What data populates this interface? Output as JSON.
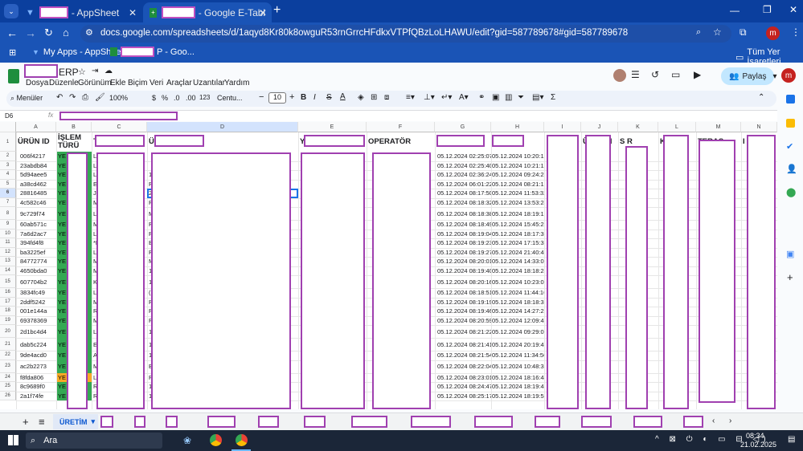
{
  "browser": {
    "tabs": [
      {
        "title": "- AppSheet"
      },
      {
        "title": "- Google E-Tablol"
      }
    ],
    "url": "docs.google.com/spreadsheets/d/1aqyd8Kr80k8owguR53rnGrrcHFdkxVTPfQBzLoLHAWU/edit?gid=587789678#gid=587789678",
    "profile_initial": "m",
    "bookmarks": [
      {
        "label": "My Apps - AppSheet"
      },
      {
        "label": "P - Goo..."
      }
    ],
    "bookmarks_folder": "Tüm Yer İşaretleri"
  },
  "sheets": {
    "doc_title_suffix": "ERP",
    "menu": [
      "Dosya",
      "Düzenle",
      "Görünüm",
      "Ekle",
      "Biçim",
      "Veri",
      "Araçlar",
      "Uzantılar",
      "Yardım"
    ],
    "share_label": "Paylaş",
    "toolbar": {
      "menus_label": "Menüler",
      "zoom": "100%",
      "currency": "$",
      "percent": "%",
      "dec_less": ".0",
      "dec_more": ".00",
      "number_fmt": "123",
      "font": "Centu...",
      "font_size": "10"
    },
    "name_box": "D6",
    "fx": "fx",
    "columns": [
      "A",
      "B",
      "C",
      "D",
      "E",
      "F",
      "G",
      "H",
      "I",
      "J",
      "K",
      "L",
      "M",
      "N"
    ],
    "headers": {
      "A": "ÜRÜN ID",
      "B": "İŞLEM TÜRÜ",
      "C": "T",
      "D": "Ü",
      "E": "Y",
      "F": "OPERATÖR",
      "J": "ÜRETİM",
      "K": "S      R",
      "L": "KALİ     O",
      "M": "TERAS",
      "N": "I"
    },
    "rows": [
      {
        "n": "2",
        "id": "006f4217",
        "b": "YE",
        "c": "LA",
        "d": "",
        "g": "05.12.2024 02:25:07",
        "h": "05.12.2024 10:20:19"
      },
      {
        "n": "3",
        "id": "23abdb84",
        "b": "YE",
        "c": "LA",
        "d": "",
        "g": "05.12.2024 02:25:40",
        "h": "05.12.2024 10:21:12"
      },
      {
        "n": "4",
        "id": "5d94aee5",
        "b": "YE",
        "c": "LA",
        "d": "1",
        "g": "05.12.2024 02:36:24",
        "h": "05.12.2024 09:24:21"
      },
      {
        "n": "5",
        "id": "a38cd462",
        "b": "YE",
        "c": "EK",
        "d": "R",
        "g": "05.12.2024 06:01:22",
        "h": "05.12.2024 08:21:12"
      },
      {
        "n": "6",
        "id": "28816485",
        "b": "YE",
        "c": "JP",
        "d": "2",
        "g": "05.12.2024 08:17:50",
        "h": "05.12.2024 11:53:32"
      },
      {
        "n": "7",
        "id": "4c582c46",
        "b": "YE",
        "c": "M",
        "d": "R",
        "g": "05.12.2024 08:18:32",
        "h": "05.12.2024 13:53:24"
      },
      {
        "n": "8",
        "id": "9c729f74",
        "b": "YE",
        "c": "LR",
        "d": "M",
        "g": "05.12.2024 08:18:38",
        "h": "05.12.2024 18:19:18"
      },
      {
        "n": "9",
        "id": "60ab571c",
        "b": "YE",
        "c": "M",
        "d": "R",
        "g": "05.12.2024 08:18:49",
        "h": "05.12.2024 15:45:21"
      },
      {
        "n": "10",
        "id": "7a6d2ac7",
        "b": "YE",
        "c": "LA",
        "d": "R",
        "g": "05.12.2024 08:19:04",
        "h": "05.12.2024 18:17:30"
      },
      {
        "n": "11",
        "id": "394fd4f8",
        "b": "YE",
        "c": "*R",
        "d": "B",
        "g": "05.12.2024 08:19:23",
        "h": "05.12.2024 17:15:37"
      },
      {
        "n": "12",
        "id": "ba3225ef",
        "b": "YE",
        "c": "LR",
        "d": "R",
        "g": "05.12.2024 08:19:27",
        "h": "05.12.2024 21:40:42"
      },
      {
        "n": "13",
        "id": "84772774",
        "b": "YE",
        "c": "M",
        "d": "M",
        "g": "05.12.2024 08:20:01",
        "h": "05.12.2024 14:33:08"
      },
      {
        "n": "14",
        "id": "4650bda0",
        "b": "YE",
        "c": "M",
        "d": "1",
        "g": "05.12.2024 08:19:40",
        "h": "05.12.2024 18:18:24"
      },
      {
        "n": "15",
        "id": "607704b2",
        "b": "YE",
        "c": "KA",
        "d": "1",
        "g": "05.12.2024 08:20:16",
        "h": "05.12.2024 10:23:03"
      },
      {
        "n": "16",
        "id": "3834fc49",
        "b": "YE",
        "c": "LE",
        "d": "(2",
        "g": "05.12.2024 08:18:51",
        "h": "05.12.2024 11:44:16"
      },
      {
        "n": "17",
        "id": "2ddf5242",
        "b": "YE",
        "c": "M",
        "d": "R",
        "g": "05.12.2024 08:19:19",
        "h": "05.12.2024 18:18:38"
      },
      {
        "n": "18",
        "id": "001e144a",
        "b": "YE",
        "c": "R",
        "d": "R",
        "g": "05.12.2024 08:19:46",
        "h": "05.12.2024 14:27:22"
      },
      {
        "n": "19",
        "id": "69378369",
        "b": "YE",
        "c": "M",
        "d": "R",
        "g": "05.12.2024 08:20:59",
        "h": "05.12.2024 12:09:42"
      },
      {
        "n": "20",
        "id": "2d1bc4d4",
        "b": "YE",
        "c": "LE",
        "d": "1",
        "g": "05.12.2024 08:21:22",
        "h": "05.12.2024 09:29:05"
      },
      {
        "n": "21",
        "id": "dab5c224",
        "b": "YE",
        "c": "EK",
        "d": "1",
        "g": "05.12.2024 08:21:41",
        "h": "05.12.2024 20:19:42"
      },
      {
        "n": "22",
        "id": "9de4acd0",
        "b": "YE",
        "c": "A",
        "d": "1",
        "g": "05.12.2024 08:21:54",
        "h": "05.12.2024 11:34:56"
      },
      {
        "n": "23",
        "id": "ac2b2273",
        "b": "YE",
        "c": "M",
        "d": "B",
        "g": "05.12.2024 08:22:04",
        "h": "05.12.2024 10:48:31"
      },
      {
        "n": "24",
        "id": "f8fda806",
        "b": "YE",
        "c": "LA",
        "d": "R",
        "g": "05.12.2024 08:23:01",
        "h": "05.12.2024 18:16:44"
      },
      {
        "n": "25",
        "id": "8c9689f0",
        "b": "YE",
        "c": "RC",
        "d": "1",
        "g": "05.12.2024 08:24:47",
        "h": "05.12.2024 18:19:43"
      },
      {
        "n": "26",
        "id": "2a1f74fe",
        "b": "YE",
        "c": "RC",
        "d": "1",
        "g": "05.12.2024 08:25:17",
        "h": "05.12.2024 18:19:53"
      }
    ],
    "sheet_tabs": {
      "active": "ÜRETİM",
      "add": "+",
      "list": "≡"
    }
  },
  "taskbar": {
    "search": "Ara",
    "time": "08:34",
    "date": "21.02.2025"
  }
}
